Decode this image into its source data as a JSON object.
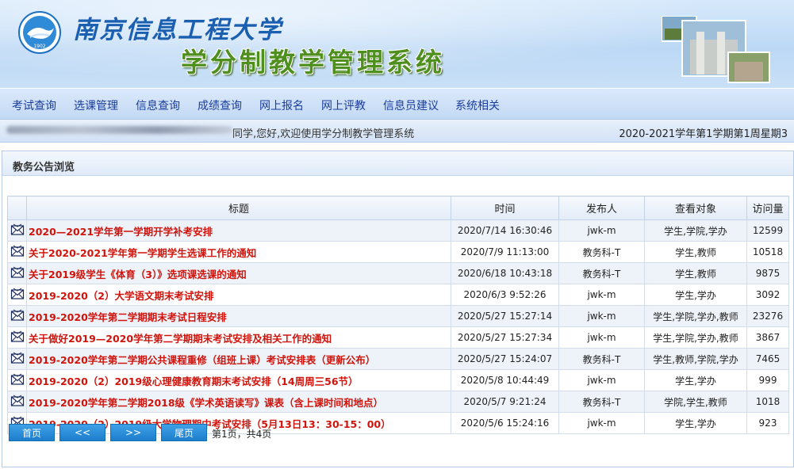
{
  "header": {
    "university_name": "南京信息工程大学",
    "system_name": "学分制教学管理系统",
    "logo_text": "1902"
  },
  "nav": {
    "items": [
      "考试查询",
      "选课管理",
      "信息查询",
      "成绩查询",
      "网上报名",
      "网上评教",
      "信息员建议",
      "系统相关"
    ]
  },
  "welcome": {
    "message": "同学,您好,欢迎使用学分制教学管理系统",
    "term": "2020-2021学年第1学期第1周星期3"
  },
  "panel": {
    "title": "教务公告浏览"
  },
  "table": {
    "columns": [
      "标题",
      "时间",
      "发布人",
      "查看对象",
      "访问量"
    ],
    "rows": [
      {
        "title": "2020—2021学年第一学期开学补考安排",
        "time": "2020/7/14 16:30:46",
        "publisher": "jwk-m",
        "audience": "学生,学院,学办",
        "visits": "12599"
      },
      {
        "title": "关于2020-2021学年第一学期学生选课工作的通知",
        "time": "2020/7/9 11:13:00",
        "publisher": "教务科-T",
        "audience": "学生,教师",
        "visits": "10518"
      },
      {
        "title": "关于2019级学生《体育（3）》选项课选课的通知",
        "time": "2020/6/18 10:43:18",
        "publisher": "教务科-T",
        "audience": "学生,教师",
        "visits": "9875"
      },
      {
        "title": "2019-2020（2）大学语文期末考试安排",
        "time": "2020/6/3 9:52:26",
        "publisher": "jwk-m",
        "audience": "学生,学办",
        "visits": "3092"
      },
      {
        "title": "2019-2020学年第二学期期末考试日程安排",
        "time": "2020/5/27 15:27:14",
        "publisher": "jwk-m",
        "audience": "学生,学院,学办,教师",
        "visits": "23276"
      },
      {
        "title": "关于做好2019—2020学年第二学期期末考试安排及相关工作的通知",
        "time": "2020/5/27 15:27:34",
        "publisher": "jwk-m",
        "audience": "学生,学院,学办,教师",
        "visits": "3867"
      },
      {
        "title": "2019-2020学年第二学期公共课程重修（组班上课）考试安排表（更新公布）",
        "time": "2020/5/27 15:24:07",
        "publisher": "教务科-T",
        "audience": "学生,教师,学院,学办",
        "visits": "7465"
      },
      {
        "title": "2019-2020（2）2019级心理健康教育期末考试安排（14周周三56节）",
        "time": "2020/5/8 10:44:49",
        "publisher": "jwk-m",
        "audience": "学生,学办",
        "visits": "999"
      },
      {
        "title": "2019-2020学年第二学期2018级《学术英语读写》课表（含上课时间和地点）",
        "time": "2020/5/7 9:21:24",
        "publisher": "教务科-T",
        "audience": "学院,学生,教师",
        "visits": "1018"
      },
      {
        "title": "2019-2020（2）2019级大学物理期中考试安排（5月13日13：30-15：00）",
        "time": "2020/5/6 15:24:16",
        "publisher": "jwk-m",
        "audience": "学生,学办",
        "visits": "923"
      }
    ]
  },
  "pager": {
    "first": "首页",
    "prev": "<<",
    "next": ">>",
    "last": "尾页",
    "info": "第1页，共4页"
  },
  "icons": {
    "row_icon": "envelope-icon"
  },
  "colors": {
    "title_red": "#d0140c",
    "nav_text": "#1a3d9c",
    "button_blue": "#1d7fcc"
  }
}
